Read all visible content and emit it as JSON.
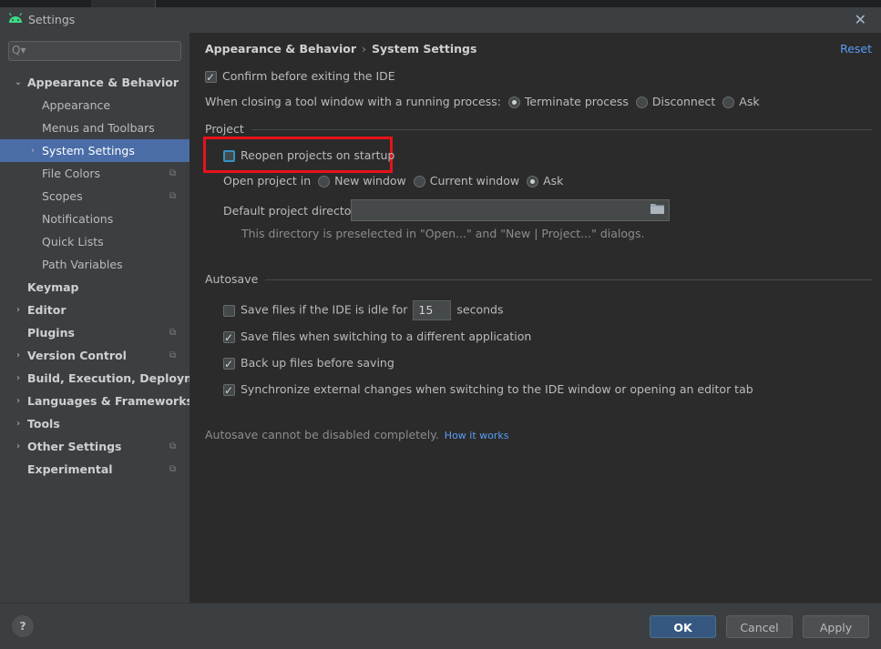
{
  "window": {
    "title": "Settings"
  },
  "search": {
    "placeholder": "",
    "value": ""
  },
  "sidebar": {
    "items": [
      {
        "label": "Appearance & Behavior",
        "expanded": true
      },
      {
        "label": "Appearance"
      },
      {
        "label": "Menus and Toolbars"
      },
      {
        "label": "System Settings",
        "selected": true
      },
      {
        "label": "File Colors"
      },
      {
        "label": "Scopes"
      },
      {
        "label": "Notifications"
      },
      {
        "label": "Quick Lists"
      },
      {
        "label": "Path Variables"
      },
      {
        "label": "Keymap"
      },
      {
        "label": "Editor"
      },
      {
        "label": "Plugins"
      },
      {
        "label": "Version Control"
      },
      {
        "label": "Build, Execution, Deployment"
      },
      {
        "label": "Languages & Frameworks"
      },
      {
        "label": "Tools"
      },
      {
        "label": "Other Settings"
      },
      {
        "label": "Experimental"
      }
    ]
  },
  "breadcrumb": {
    "parent": "Appearance & Behavior",
    "current": "System Settings"
  },
  "reset_label": "Reset",
  "general": {
    "confirm_exit": {
      "label": "Confirm before exiting the IDE",
      "checked": true
    },
    "closing_label": "When closing a tool window with a running process:",
    "closing_options": [
      {
        "label": "Terminate process",
        "selected": true
      },
      {
        "label": "Disconnect",
        "selected": false
      },
      {
        "label": "Ask",
        "selected": false
      }
    ]
  },
  "project": {
    "section_title": "Project",
    "reopen": {
      "label": "Reopen projects on startup",
      "checked": false
    },
    "open_in_label": "Open project in",
    "open_in_options": [
      {
        "label": "New window",
        "selected": false
      },
      {
        "label": "Current window",
        "selected": false
      },
      {
        "label": "Ask",
        "selected": true
      }
    ],
    "default_dir_label": "Default project directory:",
    "default_dir_value": "",
    "hint": "This directory is preselected in \"Open...\" and \"New | Project...\" dialogs."
  },
  "autosave": {
    "section_title": "Autosave",
    "idle": {
      "label_before": "Save files if the IDE is idle for",
      "value": "15",
      "label_after": "seconds",
      "checked": false
    },
    "switch_app": {
      "label": "Save files when switching to a different application",
      "checked": true
    },
    "backup": {
      "label": "Back up files before saving",
      "checked": true
    },
    "sync": {
      "label": "Synchronize external changes when switching to the IDE window or opening an editor tab",
      "checked": true
    },
    "note": "Autosave cannot be disabled completely.",
    "how_it_works": "How it works"
  },
  "footer": {
    "help": "?",
    "ok": "OK",
    "cancel": "Cancel",
    "apply": "Apply"
  },
  "colors": {
    "selection": "#4a6da7",
    "link": "#589df6",
    "highlight_box": "#e8121b",
    "ok_button": "#365880"
  }
}
